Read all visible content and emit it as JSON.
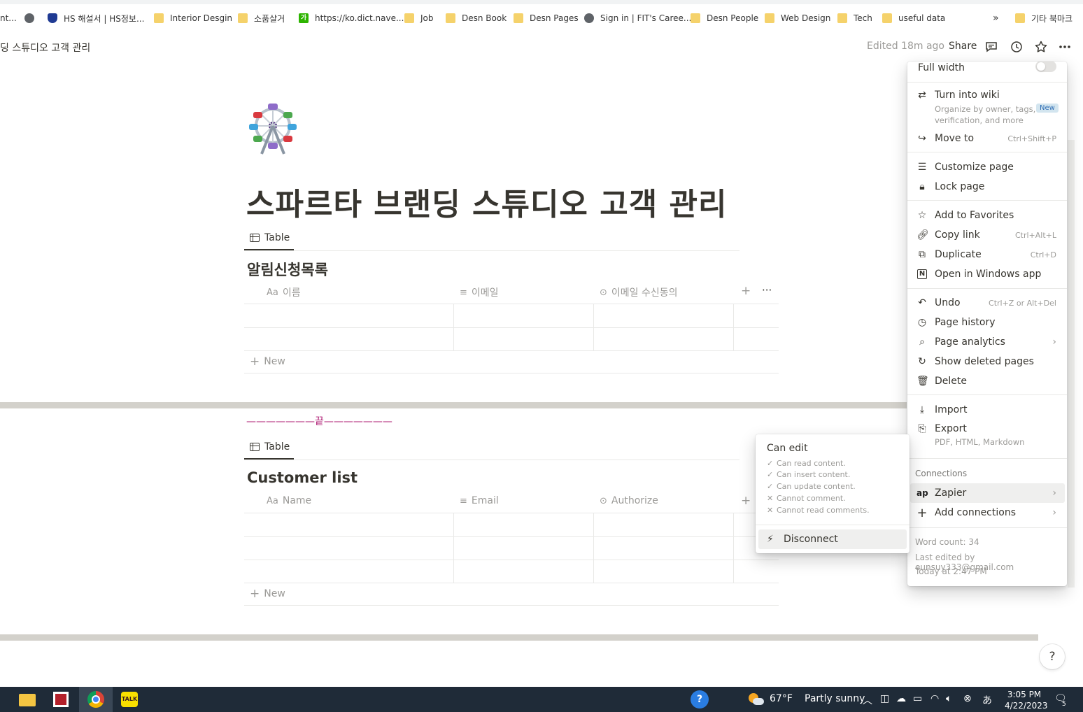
{
  "browser": {
    "bookmarks": [
      {
        "label": "nt...",
        "icon": "none"
      },
      {
        "label": "",
        "icon": "globe-icon"
      },
      {
        "label": "HS 해설서 | HS정보...",
        "icon": "shield-icon"
      },
      {
        "label": "Interior Desgin",
        "icon": "folder-icon"
      },
      {
        "label": "소품살거",
        "icon": "folder-icon"
      },
      {
        "label": "https://ko.dict.nave...",
        "icon": "naver-dict-icon"
      },
      {
        "label": "Job",
        "icon": "folder-icon"
      },
      {
        "label": "Desn Book",
        "icon": "folder-icon"
      },
      {
        "label": "Desn Pages",
        "icon": "folder-icon"
      },
      {
        "label": "Sign in | FIT's Caree...",
        "icon": "globe-icon"
      },
      {
        "label": "Desn People",
        "icon": "folder-icon"
      },
      {
        "label": "Web Design",
        "icon": "folder-icon"
      },
      {
        "label": "Tech",
        "icon": "folder-icon"
      },
      {
        "label": "useful data",
        "icon": "folder-icon"
      }
    ],
    "overflow": "»",
    "other_bookmarks": "기타 북마크"
  },
  "topbar": {
    "breadcrumb": "딩 스튜디오 고객 관리",
    "edited": "Edited 18m ago",
    "share": "Share"
  },
  "page": {
    "title": "스파르타 브랜딩 스튜디오 고객 관리",
    "end_marker": "———————끝———————",
    "db1": {
      "tab": "Table",
      "title": "알림신청목록",
      "columns": [
        {
          "icon": "Aa",
          "label": "이름"
        },
        {
          "icon": "≡",
          "label": "이메일"
        },
        {
          "icon": "⊙",
          "label": "이메일 수신동의"
        }
      ],
      "add_col": "+",
      "more": "···",
      "new_label": "New"
    },
    "db2": {
      "tab": "Table",
      "title": "Customer list",
      "columns": [
        {
          "icon": "Aa",
          "label": "Name"
        },
        {
          "icon": "≡",
          "label": "Email"
        },
        {
          "icon": "⊙",
          "label": "Authorize"
        }
      ],
      "add_col": "+",
      "new_label": "New"
    }
  },
  "menu": {
    "full_width": "Full width",
    "turn_into_wiki": "Turn into wiki",
    "wiki_desc_1": "Organize by owner, tags,",
    "wiki_desc_2": "verification, and more",
    "new_badge": "New",
    "move_to": "Move to",
    "move_to_sc": "Ctrl+Shift+P",
    "customize": "Customize page",
    "lock": "Lock page",
    "favorites": "Add to Favorites",
    "copy_link": "Copy link",
    "copy_link_sc": "Ctrl+Alt+L",
    "duplicate": "Duplicate",
    "duplicate_sc": "Ctrl+D",
    "open_app": "Open in Windows app",
    "undo": "Undo",
    "undo_sc": "Ctrl+Z or Alt+Del",
    "history": "Page history",
    "analytics": "Page analytics",
    "deleted": "Show deleted pages",
    "delete": "Delete",
    "import": "Import",
    "export": "Export",
    "export_desc": "PDF, HTML, Markdown",
    "connections": "Connections",
    "zapier": "Zapier",
    "add_connections": "Add connections",
    "word_count": "Word count: 34",
    "last_edited": "Last edited by eunsuy333@gmail.com",
    "last_edited_time": "Today at 2:47 PM"
  },
  "popover": {
    "title": "Can edit",
    "perms": [
      {
        "mark": "✓",
        "text": "Can read content."
      },
      {
        "mark": "✓",
        "text": "Can insert content."
      },
      {
        "mark": "✓",
        "text": "Can update content."
      },
      {
        "mark": "✕",
        "text": "Cannot comment."
      },
      {
        "mark": "✕",
        "text": "Cannot read comments."
      }
    ],
    "disconnect": "Disconnect"
  },
  "help": "?",
  "taskbar": {
    "weather_temp": "67°F",
    "weather_desc": "Partly sunny",
    "time": "3:05 PM",
    "date": "4/22/2023",
    "notif_count": "5"
  },
  "colors": {
    "accent_end_marker": "#ad1a72",
    "taskbar": "#1f2b38",
    "divider": "#d3d1cb"
  }
}
